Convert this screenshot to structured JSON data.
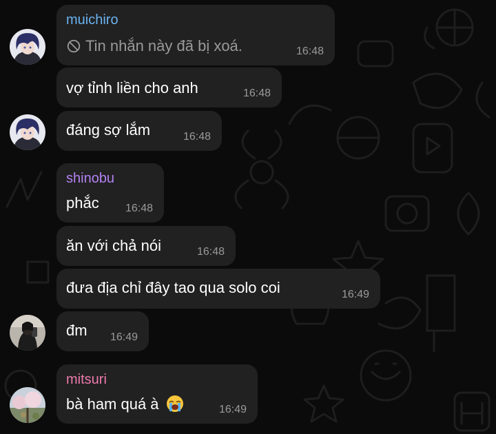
{
  "theme": {
    "background": "#0b0b0b",
    "bubble": "#212121",
    "text": "#ffffff",
    "time": "#9a9a9a",
    "sender_colors": {
      "muichiro": "#6ab3f3",
      "shinobu": "#b383f3",
      "mitsuri": "#ee7aae"
    }
  },
  "messages": [
    {
      "sender": "muichiro",
      "deleted_icon": "ban-icon",
      "text": "Tin nhắn này đã bị xoá.",
      "time": "16:48"
    },
    {
      "text": "vợ tỉnh liền cho anh",
      "time": "16:48"
    },
    {
      "text": "đáng sợ lắm",
      "time": "16:48"
    },
    {
      "sender": "shinobu",
      "text": "phắc",
      "time": "16:48"
    },
    {
      "text": "ăn với chả nói",
      "time": "16:48"
    },
    {
      "text": "đưa địa chỉ đây tao qua solo coi",
      "time": "16:49"
    },
    {
      "text": "đm",
      "time": "16:49"
    },
    {
      "sender": "mitsuri",
      "text": "bà ham quá à",
      "emoji": "crying-face-emoji",
      "time": "16:49"
    }
  ]
}
